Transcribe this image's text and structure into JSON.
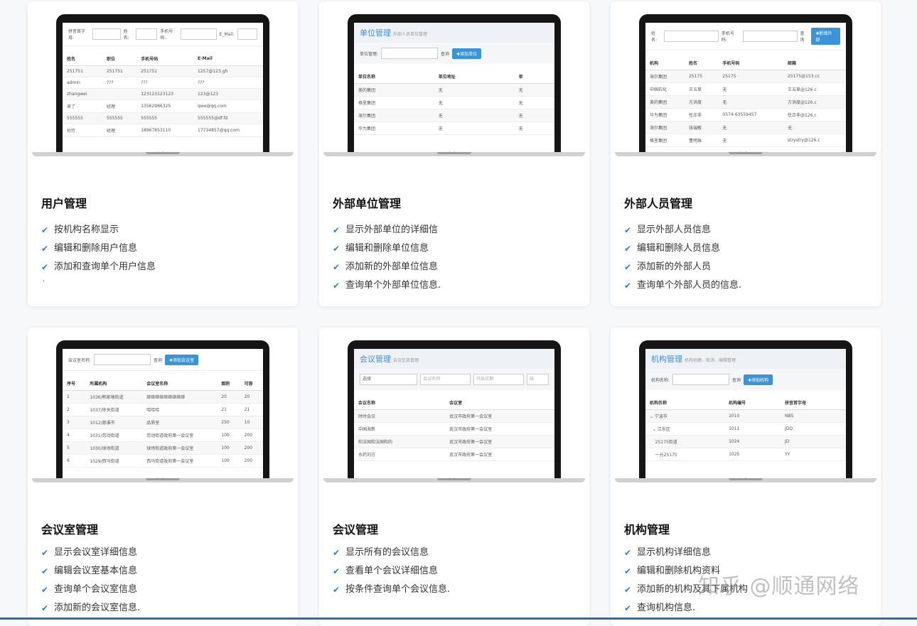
{
  "watermark": "知乎 @顺通网络",
  "laptop_brand": "MacBook",
  "cards": [
    {
      "title": "用户管理",
      "features": [
        "按机构名称显示",
        "编辑和删除用户信息",
        "添加和查询单个用户信息"
      ],
      "trailing_dot": ".",
      "screen": {
        "filters": [
          "拼音首字母:",
          "姓名:",
          "手机号码:",
          "E_Mail:"
        ],
        "columns": [
          "姓名",
          "职位",
          "手机号码",
          "E-Mail"
        ],
        "rows": [
          [
            "251751",
            "251751",
            "251751",
            "1257@123.gh"
          ],
          [
            "admin",
            "???",
            "???",
            "???"
          ],
          [
            "zhangwei",
            "",
            "123123123123",
            "123@123"
          ],
          [
            "来了",
            "经理",
            "13562986325",
            "qwe@qq.com"
          ],
          [
            "555555",
            "555555",
            "555555",
            "555555@df.fd"
          ],
          [
            "孙玲",
            "经理",
            "18967853110",
            "17734857@qq.com"
          ]
        ]
      }
    },
    {
      "title": "外部单位管理",
      "features": [
        "显示外部单位的详细信",
        "编辑和删除单位信息",
        "添加新的外部单位信息",
        "查询单个外部单位信息."
      ],
      "screen": {
        "heading": "单位管理",
        "subheading": "外部人员单位管理",
        "filter_label": "单位管理:",
        "search": "查询",
        "add": "✚添加单位",
        "columns": [
          "单位名称",
          "单位地址",
          "单"
        ],
        "rows": [
          [
            "美的集团",
            "无",
            "无"
          ],
          [
            "格里集团",
            "无",
            "无"
          ],
          [
            "海尔集团",
            "无",
            "无"
          ],
          [
            "华为集团",
            "无",
            "无"
          ]
        ]
      }
    },
    {
      "title": "外部人员管理",
      "features": [
        "显示外部人员信息",
        "编辑和删除人员信息",
        "添加新的外部人员",
        "查询单个外部人员的信息."
      ],
      "screen": {
        "filters": [
          "姓名:",
          "手机号码:"
        ],
        "search": "查询",
        "add": "✚新增外部",
        "columns": [
          "机构",
          "姓名",
          "手机号码",
          "邮箱"
        ],
        "rows": [
          [
            "海尔集团",
            "25175",
            "25175",
            "25175@153.cc"
          ],
          [
            "中国石化",
            "王五草",
            "无",
            "王五草@126.c"
          ],
          [
            "美的集团",
            "方洪度",
            "无",
            "方洪度@126.c"
          ],
          [
            "华为集团",
            "任正非",
            "0574-63559457",
            "任正非@126.c"
          ],
          [
            "海尔集团",
            "张瑞敏",
            "无",
            "无"
          ],
          [
            "格里集团",
            "董明珠",
            "无",
            "strystry@126.c"
          ]
        ]
      }
    },
    {
      "title": "会议室管理",
      "features": [
        "显示会议室详细信息",
        "编辑会议室基本信息",
        "查询单个会议室信息",
        "添加新的会议室信息."
      ],
      "screen": {
        "filter_label": "会议室名称:",
        "search": "查询",
        "add": "✚添加会议室",
        "columns": [
          "序号",
          "所属机构",
          "会议室名称",
          "面积",
          "可容"
        ],
        "rows": [
          [
            "1",
            "1036/韩家墩街道",
            "继继继继继继继继继",
            "20",
            "20"
          ],
          [
            "2",
            "1037/徐关街道",
            "哈哈哈",
            "21",
            "21"
          ],
          [
            "3",
            "1012/慈溪市",
            "品质室",
            "250",
            "10"
          ],
          [
            "4",
            "1031/劳动街道",
            "劳动街道政府第一会议室",
            "100",
            "200"
          ],
          [
            "5",
            "1030/球场街道",
            "球场街道政府第一会议室",
            "100",
            "200"
          ],
          [
            "6",
            "1029/西马街道",
            "西马街道政府第一会议室",
            "100",
            "200"
          ]
        ]
      }
    },
    {
      "title": "会议管理",
      "features": [
        "显示所有的会议信息",
        "查看单个会议详细信息",
        "按条件查询单个会议信息."
      ],
      "screen": {
        "heading": "会议管理",
        "subheading": "会议信息管理",
        "select": "选择",
        "placeholders": [
          "会议名称",
          "开始日期",
          "结"
        ],
        "columns": [
          "会议名称",
          "会议室"
        ],
        "rows": [
          [
            "时时会议",
            "武汉市政府第一会议室"
          ],
          [
            "中国海新",
            "武汉市政府第一会议室"
          ],
          [
            "和法国和法国和的",
            "武汉市政府第一会议室"
          ],
          [
            "水药刘方",
            "武汉市政府第一会议室"
          ]
        ]
      }
    },
    {
      "title": "机构管理",
      "features": [
        "显示机构详细信息",
        "编辑和删除机构资料",
        "添加新的机构及其下属机构",
        "查询机构信息."
      ],
      "screen": {
        "heading": "机构管理",
        "subheading": "机构创建、取消、编辑管理",
        "filter_label": "机构名称:",
        "search": "查询",
        "add": "✚添加机构",
        "columns": [
          "机构名称",
          "机构编号",
          "拼音首字母"
        ],
        "rows": [
          [
            "⌄ 宁波市",
            "1010",
            "NBS"
          ],
          [
            "  ⌄ 江东区",
            "1011",
            "JDQ"
          ],
          [
            "    25175街道",
            "1024",
            "JD"
          ],
          [
            "    一元25175",
            "1025",
            "YY"
          ]
        ]
      }
    }
  ]
}
